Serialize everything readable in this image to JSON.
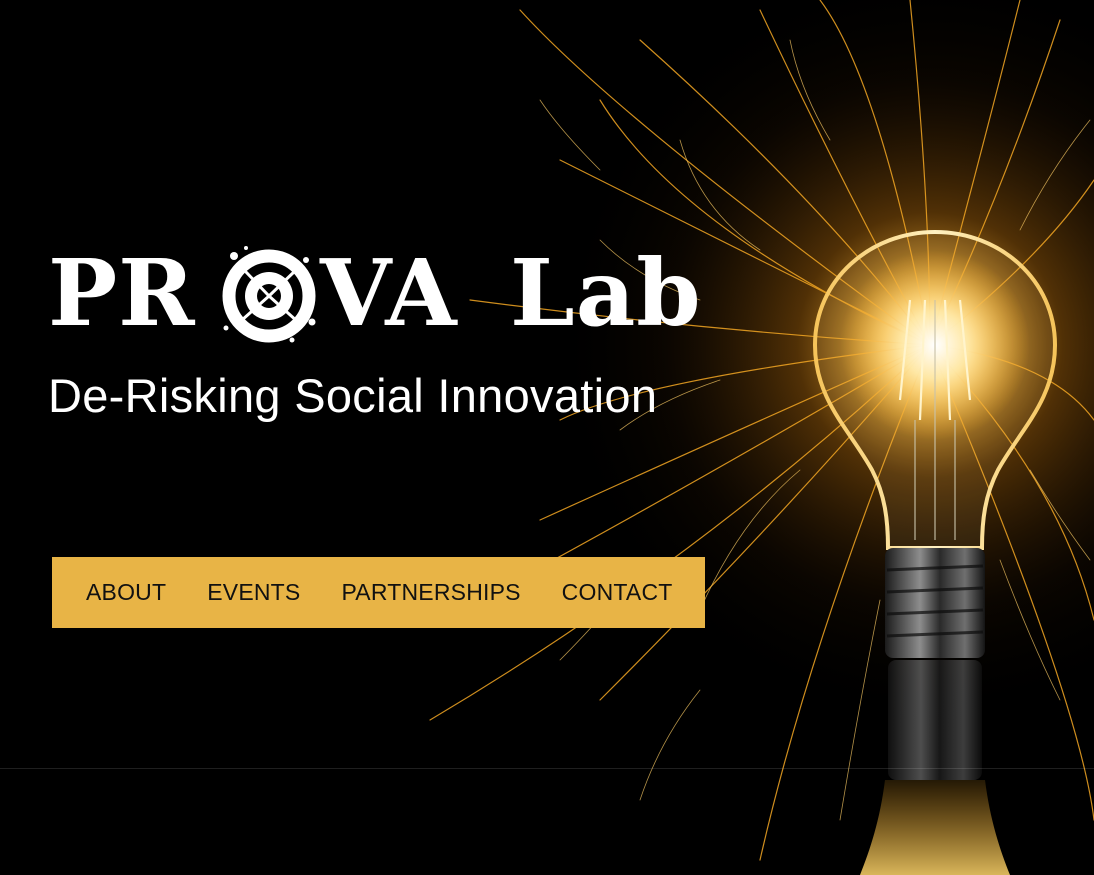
{
  "brand": {
    "name_part1": "PR",
    "name_part2": "VA",
    "name_part3": "Lab",
    "logo_icon": "splatter-o-icon",
    "tagline": "De-Risking Social Innovation"
  },
  "nav": {
    "items": [
      {
        "label": "ABOUT"
      },
      {
        "label": "EVENTS"
      },
      {
        "label": "PARTNERSHIPS"
      },
      {
        "label": "CONTACT"
      }
    ]
  },
  "hero": {
    "image": "lightbulb-sparks-photo"
  },
  "colors": {
    "background": "#000000",
    "nav_bar": "#e8b446",
    "nav_text": "#111111",
    "logo_text": "#ffffff",
    "spark": "#f2a623"
  }
}
